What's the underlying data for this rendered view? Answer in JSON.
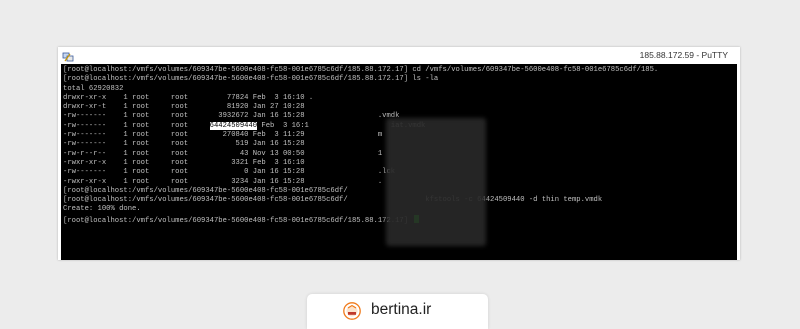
{
  "window": {
    "title": "185.88.172.59 - PuTTY",
    "app_icon": "putty-icon"
  },
  "terminal": {
    "lines": [
      {
        "pre": "[root@localhost:/vmfs/volumes/609347be-5600e408-fc58-001e6785c6df/185.88.172.17] cd /vmfs/volumes/609347be-5600e408-fc58-001e6785c6df/185.",
        "hl": "",
        "post": ""
      },
      {
        "pre": "[root@localhost:/vmfs/volumes/609347be-5600e408-fc58-001e6785c6df/185.88.172.17] ls -la",
        "hl": "",
        "post": ""
      },
      {
        "pre": "total 62920832",
        "hl": "",
        "post": ""
      },
      {
        "pre": "drwxr-xr-x    1 root     root         77824 Feb  3 16:10 .",
        "hl": "",
        "post": ""
      },
      {
        "pre": "drwxr-xr-t    1 root     root         81920 Jan 27 10:28",
        "hl": "",
        "post": ""
      },
      {
        "pre": "-rw-------    1 root     root       3932672 Jan 16 15:28                 .vmdk",
        "hl": "",
        "post": ""
      },
      {
        "pre": "-rw-------    1 root     root     ",
        "hl": "64424509440",
        "post": " Feb  3 16:1                   iat.vmdk"
      },
      {
        "pre": "-rw-------    1 root     root        270840 Feb  3 11:29                 m",
        "hl": "",
        "post": ""
      },
      {
        "pre": "-rw-------    1 root     root           519 Jan 16 15:28",
        "hl": "",
        "post": ""
      },
      {
        "pre": "-rw-r--r--    1 root     root            43 Nov 13 00:50                 1",
        "hl": "",
        "post": ""
      },
      {
        "pre": "-rwxr-xr-x    1 root     root          3321 Feb  3 16:10",
        "hl": "",
        "post": ""
      },
      {
        "pre": "-rw-------    1 root     root             0 Jan 16 15:28                 .lck",
        "hl": "",
        "post": ""
      },
      {
        "pre": "-rwxr-xr-x    1 root     root          3234 Jan 16 15:28                 .",
        "hl": "",
        "post": ""
      },
      {
        "pre": "[root@localhost:/vmfs/volumes/609347be-5600e408-fc58-001e6785c6df/",
        "hl": "",
        "post": ""
      },
      {
        "pre": "[root@localhost:/vmfs/volumes/609347be-5600e408-fc58-001e6785c6df/                  kfstools -c 64424509440 -d thin temp.vmdk",
        "hl": "",
        "post": ""
      },
      {
        "pre": "Create: 100% done.",
        "hl": "",
        "post": ""
      },
      {
        "pre": "[root@localhost:/vmfs/volumes/609347be-5600e408-fc58-001e6785c6df/185.88.172.17] ",
        "hl": "",
        "post": ""
      }
    ],
    "cursor_color": "#00dd00"
  },
  "footer": {
    "brand": "bertina.ir",
    "logo_text": "bertina",
    "logo_icon": "bertina-logo-icon"
  }
}
